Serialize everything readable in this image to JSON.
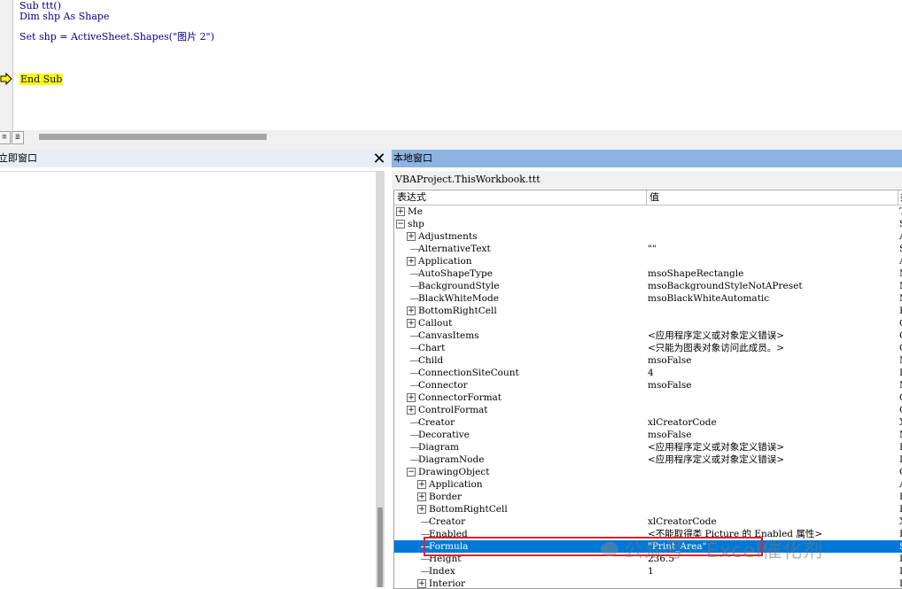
{
  "code": {
    "lines": [
      "Sub ttt()",
      "Dim shp As Shape",
      "Set shp = ActiveSheet.Shapes(\"图片 2\")",
      "End Sub"
    ]
  },
  "immediate_window": {
    "title": "立即窗口"
  },
  "locals_window": {
    "title": "本地窗口",
    "context": "VBAProject.ThisWorkbook.ttt",
    "columns": {
      "expression": "表达式",
      "value": "值",
      "type": "类"
    },
    "rows": [
      {
        "name": "Me",
        "value": "",
        "type": "T"
      },
      {
        "name": "shp",
        "value": "",
        "type": "S"
      },
      {
        "name": "Adjustments",
        "value": "",
        "type": "A"
      },
      {
        "name": "AlternativeText",
        "value": "\"\"",
        "type": "S"
      },
      {
        "name": "Application",
        "value": "",
        "type": "A"
      },
      {
        "name": "AutoShapeType",
        "value": "msoShapeRectangle",
        "type": "M"
      },
      {
        "name": "BackgroundStyle",
        "value": "msoBackgroundStyleNotAPreset",
        "type": "M"
      },
      {
        "name": "BlackWhiteMode",
        "value": "msoBlackWhiteAutomatic",
        "type": "M"
      },
      {
        "name": "BottomRightCell",
        "value": "",
        "type": "R"
      },
      {
        "name": "Callout",
        "value": "",
        "type": "C"
      },
      {
        "name": "CanvasItems",
        "value": "<应用程序定义或对象定义错误>",
        "type": "C"
      },
      {
        "name": "Chart",
        "value": "<只能为图表对象访问此成员。>",
        "type": "C"
      },
      {
        "name": "Child",
        "value": "msoFalse",
        "type": "M"
      },
      {
        "name": "ConnectionSiteCount",
        "value": "4",
        "type": "L"
      },
      {
        "name": "Connector",
        "value": "msoFalse",
        "type": "M"
      },
      {
        "name": "ConnectorFormat",
        "value": "",
        "type": "C"
      },
      {
        "name": "ControlFormat",
        "value": "",
        "type": "C"
      },
      {
        "name": "Creator",
        "value": "xlCreatorCode",
        "type": "X"
      },
      {
        "name": "Decorative",
        "value": "msoFalse",
        "type": "M"
      },
      {
        "name": "Diagram",
        "value": "<应用程序定义或对象定义错误>",
        "type": "D"
      },
      {
        "name": "DiagramNode",
        "value": "<应用程序定义或对象定义错误>",
        "type": "D"
      },
      {
        "name": "DrawingObject",
        "value": "",
        "type": "O"
      },
      {
        "name": "Application",
        "value": "",
        "type": "A"
      },
      {
        "name": "Border",
        "value": "",
        "type": "B"
      },
      {
        "name": "BottomRightCell",
        "value": "",
        "type": "R"
      },
      {
        "name": "Creator",
        "value": "xlCreatorCode",
        "type": "X"
      },
      {
        "name": "Enabled",
        "value": "<不能取得类 Picture 的 Enabled 属性>",
        "type": "E"
      },
      {
        "name": "Formula",
        "value": "\"Print_Area\"",
        "type": "S"
      },
      {
        "name": "Height",
        "value": "236.5",
        "type": "D"
      },
      {
        "name": "Index",
        "value": "1",
        "type": "L"
      },
      {
        "name": "Interior",
        "value": "",
        "type": "I"
      }
    ]
  },
  "watermark": {
    "text": "公众号 · Excel催化剂"
  }
}
